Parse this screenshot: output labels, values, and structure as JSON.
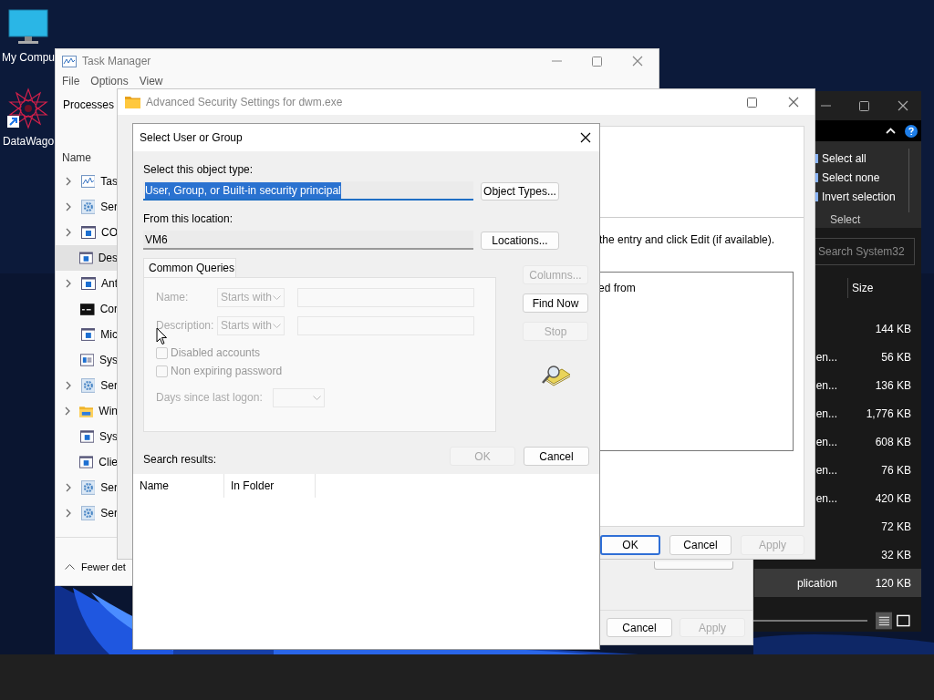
{
  "desktop_icons": [
    {
      "label": "My Compu",
      "kind": "monitor"
    },
    {
      "label": "DataWago",
      "kind": "star"
    }
  ],
  "task_manager": {
    "title": "Task Manager",
    "menu": [
      "File",
      "Options",
      "View"
    ],
    "tab": "Processes",
    "column": "Name",
    "rows": [
      {
        "name": "Tas",
        "kind": "chart",
        "expandable": true,
        "selected": false
      },
      {
        "name": "Ser",
        "kind": "gear",
        "expandable": true,
        "selected": false
      },
      {
        "name": "CO",
        "kind": "app",
        "expandable": true,
        "selected": false
      },
      {
        "name": "Des",
        "kind": "app",
        "expandable": false,
        "selected": true
      },
      {
        "name": "Ant",
        "kind": "app",
        "expandable": true,
        "selected": false
      },
      {
        "name": "Cor",
        "kind": "console",
        "expandable": false,
        "selected": false
      },
      {
        "name": "Mic",
        "kind": "app",
        "expandable": false,
        "selected": false
      },
      {
        "name": "Sys",
        "kind": "list",
        "expandable": false,
        "selected": false
      },
      {
        "name": "Ser",
        "kind": "gear",
        "expandable": true,
        "selected": false
      },
      {
        "name": "Win",
        "kind": "folder",
        "expandable": true,
        "selected": false
      },
      {
        "name": "Sys",
        "kind": "app",
        "expandable": false,
        "selected": false
      },
      {
        "name": "Clie",
        "kind": "app",
        "expandable": false,
        "selected": false
      },
      {
        "name": "Ser",
        "kind": "gear",
        "expandable": true,
        "selected": false
      },
      {
        "name": "Ser",
        "kind": "gear",
        "expandable": true,
        "selected": false
      }
    ],
    "footer": "Fewer det"
  },
  "properties_window": {
    "buttons": [
      {
        "label": "Cancel",
        "disabled": false
      },
      {
        "label": "Apply",
        "disabled": true
      }
    ]
  },
  "advanced_security": {
    "title": "Advanced Security Settings for dwm.exe",
    "instruction": "the entry and click Edit (if available).",
    "list_text": "ed from",
    "buttons": [
      {
        "label": "OK",
        "disabled": false,
        "default": true
      },
      {
        "label": "Cancel",
        "disabled": false,
        "default": false
      },
      {
        "label": "Apply",
        "disabled": true,
        "default": false
      }
    ]
  },
  "explorer": {
    "ribbon": [
      "Select all",
      "Select none",
      "Invert selection"
    ],
    "group": "Select",
    "search": {
      "placeholder": "Search System32"
    },
    "column": "Size",
    "rows": [
      {
        "size": "144 KB",
        "selected": false
      },
      {
        "type": "en...",
        "size": "56 KB",
        "selected": false
      },
      {
        "type": "en...",
        "size": "136 KB",
        "selected": false
      },
      {
        "type": "en...",
        "size": "1,776 KB",
        "selected": false
      },
      {
        "type": "en...",
        "size": "608 KB",
        "selected": false
      },
      {
        "type": "en...",
        "size": "76 KB",
        "selected": false
      },
      {
        "type": "en...",
        "size": "420 KB",
        "selected": false
      },
      {
        "size": "72 KB",
        "selected": false
      },
      {
        "size": "32 KB",
        "selected": false
      },
      {
        "type": "plication",
        "size": "120 KB",
        "selected": true
      }
    ]
  },
  "dialog": {
    "title": "Select User or Group",
    "object_type": {
      "label": "Select this object type:",
      "value": "User, Group, or Built-in security principal",
      "text_selected": true,
      "button": "Object Types..."
    },
    "location": {
      "label": "From this location:",
      "value": "VM6",
      "button": "Locations..."
    },
    "tab": "Common Queries",
    "queries": [
      {
        "label": "Name:",
        "option": "Starts with",
        "disabled": true
      },
      {
        "label": "Description:",
        "option": "Starts with",
        "disabled": true
      }
    ],
    "checkboxes": [
      {
        "label": "Disabled accounts",
        "checked": false,
        "disabled": true
      },
      {
        "label": "Non expiring password",
        "checked": false,
        "disabled": true
      }
    ],
    "days_label": "Days since last logon:",
    "side_buttons": [
      {
        "label": "Columns...",
        "disabled": true
      },
      {
        "label": "Find Now",
        "disabled": false
      },
      {
        "label": "Stop",
        "disabled": true
      }
    ],
    "buttons": [
      {
        "label": "OK",
        "disabled": true
      },
      {
        "label": "Cancel",
        "disabled": false
      }
    ],
    "results_label": "Search results:",
    "results_columns": [
      "Name",
      "In Folder"
    ]
  }
}
